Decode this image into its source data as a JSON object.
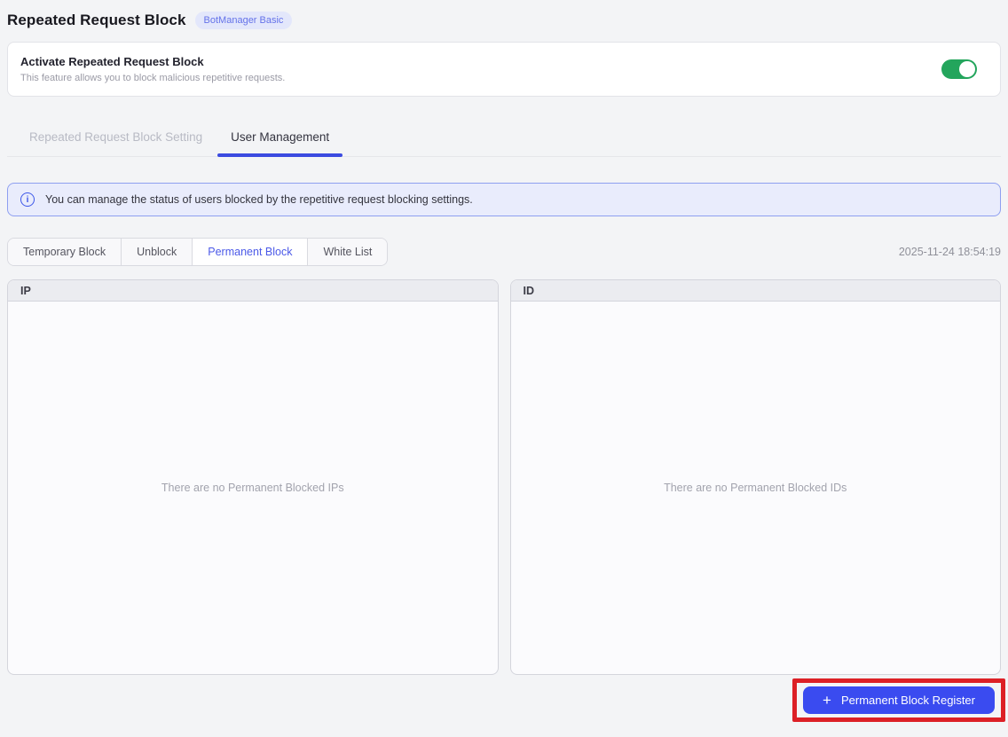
{
  "page": {
    "title": "Repeated Request Block",
    "badge": "BotManager Basic"
  },
  "activate_card": {
    "title": "Activate Repeated Request Block",
    "description": "This feature allows you to block malicious repetitive requests.",
    "toggle_state": "on"
  },
  "tabs": [
    {
      "label": "Repeated Request Block Setting",
      "active": false
    },
    {
      "label": "User Management",
      "active": true
    }
  ],
  "info_banner": {
    "icon_glyph": "i",
    "text": "You can manage the status of users blocked by the repetitive request blocking settings."
  },
  "filters": {
    "buttons": [
      {
        "label": "Temporary Block",
        "active": false
      },
      {
        "label": "Unblock",
        "active": false
      },
      {
        "label": "Permanent Block",
        "active": true
      },
      {
        "label": "White List",
        "active": false
      }
    ],
    "timestamp": "2025-11-24 18:54:19"
  },
  "panels": [
    {
      "header": "IP",
      "empty_text": "There are no Permanent Blocked IPs"
    },
    {
      "header": "ID",
      "empty_text": "There are no Permanent Blocked IDs"
    }
  ],
  "footer": {
    "register_button": {
      "icon_glyph": "+",
      "label": "Permanent Block Register"
    }
  },
  "colors": {
    "accent_blue": "#3b4bf0",
    "tab_underline_blue": "#3b4be0",
    "active_filter_text": "#4c5ae8",
    "toggle_green": "#23a55c",
    "annotation_red": "#dc2026",
    "banner_bg": "#e9ecfc",
    "banner_border": "#8e9ff0",
    "badge_bg": "#e3e7fb",
    "badge_text": "#6472e9",
    "page_bg": "#f3f4f6"
  }
}
